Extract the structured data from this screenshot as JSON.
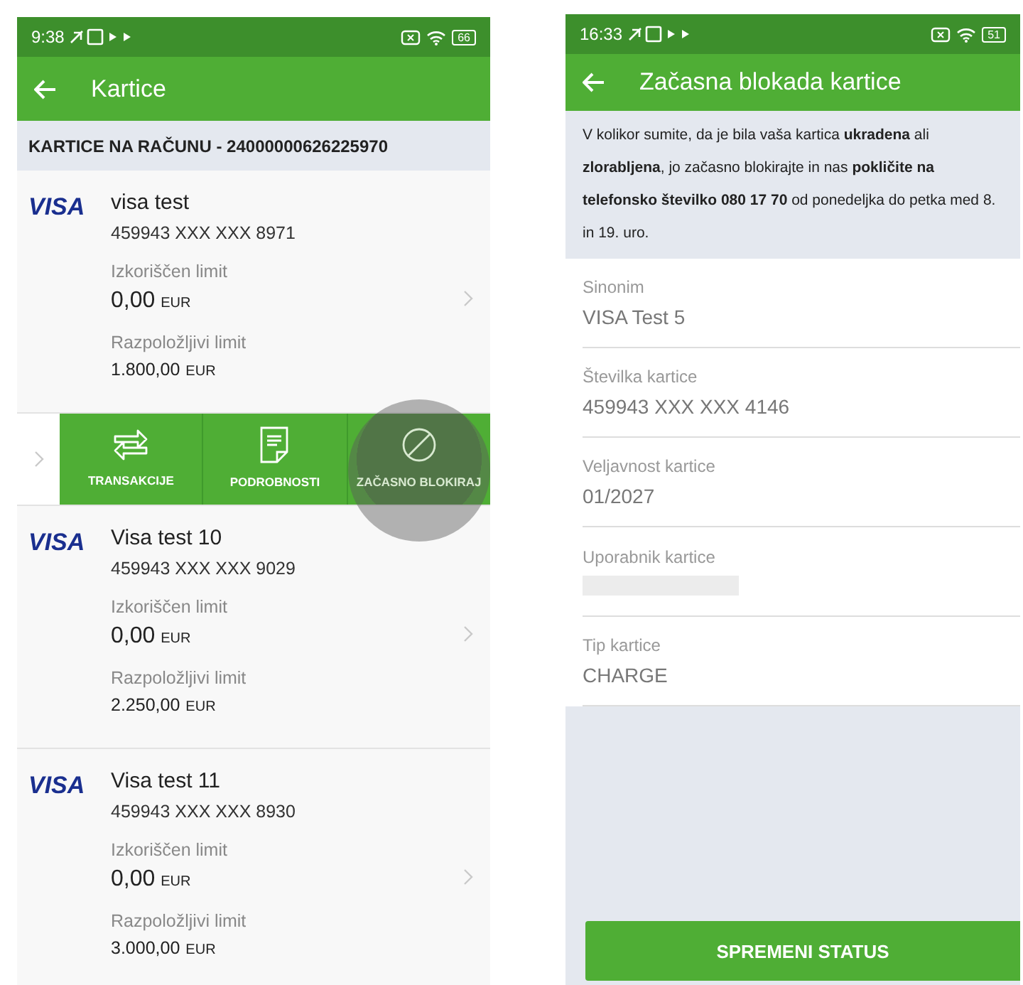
{
  "left_screen": {
    "status_bar": {
      "time": "9:38",
      "battery": "66"
    },
    "app_bar": {
      "title": "Kartice"
    },
    "section_header": "KARTICE NA RAČUNU - 24000000626225970",
    "cards": [
      {
        "brand": "VISA",
        "name": "visa test",
        "number": "459943 XXX XXX 8971",
        "used_label": "Izkoriščen limit",
        "used_amount": "0,00",
        "used_currency": "EUR",
        "available_label": "Razpoložljivi limit",
        "available_amount": "1.800,00",
        "available_currency": "EUR"
      },
      {
        "brand": "VISA",
        "name": "Visa test 10",
        "number": "459943 XXX XXX 9029",
        "used_label": "Izkoriščen limit",
        "used_amount": "0,00",
        "used_currency": "EUR",
        "available_label": "Razpoložljivi limit",
        "available_amount": "2.250,00",
        "available_currency": "EUR"
      },
      {
        "brand": "VISA",
        "name": "Visa test 11",
        "number": "459943 XXX XXX 8930",
        "used_label": "Izkoriščen limit",
        "used_amount": "0,00",
        "used_currency": "EUR",
        "available_label": "Razpoložljivi limit",
        "available_amount": "3.000,00",
        "available_currency": "EUR"
      }
    ],
    "card_actions": [
      {
        "kind": "transactions",
        "label": "TRANSAKCIJE",
        "pressed": false
      },
      {
        "kind": "details",
        "label": "PODROBNOSTI",
        "pressed": false
      },
      {
        "kind": "block",
        "label": "ZAČASNO BLOKIRAJ",
        "pressed": true
      }
    ]
  },
  "right_screen": {
    "status_bar": {
      "time": "16:33",
      "battery": "51"
    },
    "app_bar": {
      "title": "Začasna blokada kartice"
    },
    "notice": "V kolikor sumite, da je bila vaša kartica **ukradena** ali **zlorabljena**, jo začasno blokirajte in nas **pokličite na telefonsko številko 080 17 70** od ponedeljka do petka med 8. in 19. uro.",
    "fields": [
      {
        "kind": "text",
        "label": "Sinonim",
        "value": "VISA Test 5"
      },
      {
        "kind": "text",
        "label": "Številka kartice",
        "value": "459943 XXX XXX 4146"
      },
      {
        "kind": "text",
        "label": "Veljavnost kartice",
        "value": "01/2027"
      },
      {
        "kind": "redacted",
        "label": "Uporabnik kartice"
      },
      {
        "kind": "text",
        "label": "Tip kartice",
        "value": "CHARGE"
      }
    ],
    "button": "SPREMENI STATUS"
  }
}
